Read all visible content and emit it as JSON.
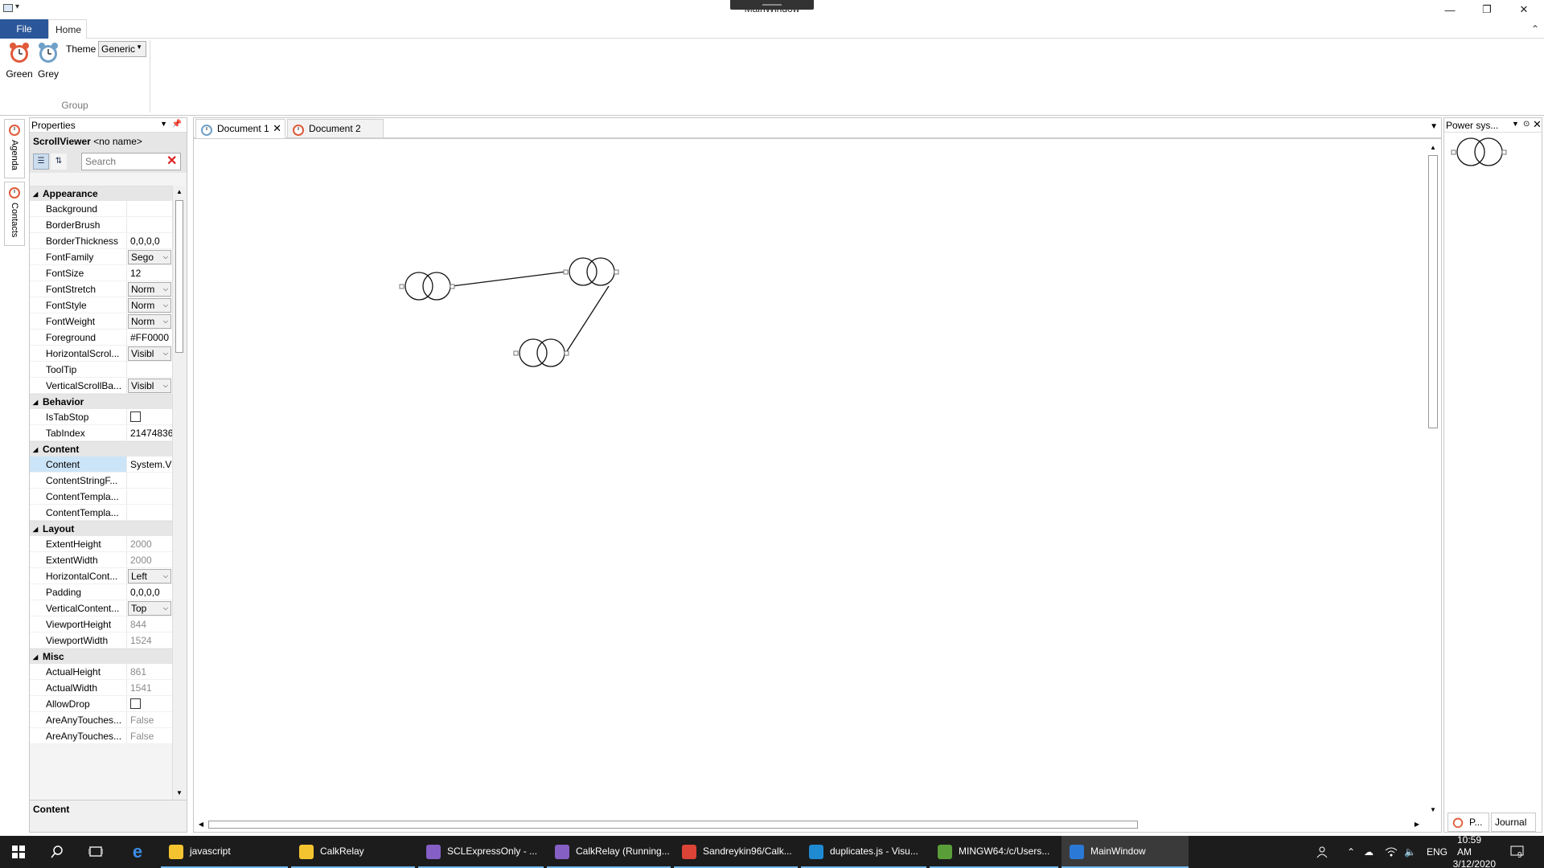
{
  "window": {
    "title": "MainWindow",
    "minimize": "—",
    "restore": "❐",
    "close": "✕"
  },
  "ribbon": {
    "tabs": [
      "File",
      "Home"
    ],
    "buttons": [
      {
        "label": "Green"
      },
      {
        "label": "Grey"
      }
    ],
    "theme_label": "Theme",
    "theme_value": "Generic",
    "group_label": "Group",
    "collapse_glyph": "⌃"
  },
  "sidebar": {
    "tabs": [
      "Agenda",
      "Contacts"
    ]
  },
  "properties": {
    "header": "Properties",
    "object_type": "ScrollViewer",
    "object_name": "<no name>",
    "search_placeholder": "Search",
    "footer": "Content",
    "categories": [
      {
        "name": "Appearance",
        "rows": [
          {
            "name": "Background",
            "value": "",
            "kind": "text"
          },
          {
            "name": "BorderBrush",
            "value": "",
            "kind": "text"
          },
          {
            "name": "BorderThickness",
            "value": "0,0,0,0",
            "kind": "text"
          },
          {
            "name": "FontFamily",
            "value": "Sego",
            "kind": "combo"
          },
          {
            "name": "FontSize",
            "value": "12",
            "kind": "text"
          },
          {
            "name": "FontStretch",
            "value": "Norm",
            "kind": "combo"
          },
          {
            "name": "FontStyle",
            "value": "Norm",
            "kind": "combo"
          },
          {
            "name": "FontWeight",
            "value": "Norm",
            "kind": "combo"
          },
          {
            "name": "Foreground",
            "value": "#FF0000",
            "kind": "text"
          },
          {
            "name": "HorizontalScrol...",
            "value": "Visibl",
            "kind": "combo"
          },
          {
            "name": "ToolTip",
            "value": "",
            "kind": "text"
          },
          {
            "name": "VerticalScrollBa...",
            "value": "Visibl",
            "kind": "combo"
          }
        ]
      },
      {
        "name": "Behavior",
        "rows": [
          {
            "name": "IsTabStop",
            "value": "",
            "kind": "check"
          },
          {
            "name": "TabIndex",
            "value": "21474836",
            "kind": "text"
          }
        ]
      },
      {
        "name": "Content",
        "rows": [
          {
            "name": "Content",
            "value": "System.V",
            "kind": "text",
            "selected": true
          },
          {
            "name": "ContentStringF...",
            "value": "",
            "kind": "text"
          },
          {
            "name": "ContentTempla...",
            "value": "",
            "kind": "text"
          },
          {
            "name": "ContentTempla...",
            "value": "",
            "kind": "text"
          }
        ]
      },
      {
        "name": "Layout",
        "rows": [
          {
            "name": "ExtentHeight",
            "value": "2000",
            "kind": "readonly"
          },
          {
            "name": "ExtentWidth",
            "value": "2000",
            "kind": "readonly"
          },
          {
            "name": "HorizontalCont...",
            "value": "Left",
            "kind": "combo"
          },
          {
            "name": "Padding",
            "value": "0,0,0,0",
            "kind": "text"
          },
          {
            "name": "VerticalContent...",
            "value": "Top",
            "kind": "combo"
          },
          {
            "name": "ViewportHeight",
            "value": "844",
            "kind": "readonly"
          },
          {
            "name": "ViewportWidth",
            "value": "1524",
            "kind": "readonly"
          }
        ]
      },
      {
        "name": "Misc",
        "rows": [
          {
            "name": "ActualHeight",
            "value": "861",
            "kind": "readonly"
          },
          {
            "name": "ActualWidth",
            "value": "1541",
            "kind": "readonly"
          },
          {
            "name": "AllowDrop",
            "value": "",
            "kind": "check"
          },
          {
            "name": "AreAnyTouches...",
            "value": "False",
            "kind": "readonly"
          },
          {
            "name": "AreAnyTouches...",
            "value": "False",
            "kind": "readonly"
          }
        ]
      }
    ]
  },
  "documents": {
    "tabs": [
      {
        "label": "Document 1",
        "active": true
      },
      {
        "label": "Document 2",
        "active": false
      }
    ]
  },
  "right_panel": {
    "header": "Power sys...",
    "bottom_tabs": [
      "P...",
      "Journal"
    ]
  },
  "taskbar": {
    "apps": [
      {
        "label": "javascript",
        "color": "#f4c430"
      },
      {
        "label": "CalkRelay",
        "color": "#f4c430"
      },
      {
        "label": "SCLExpressOnly - ...",
        "color": "#865fc5"
      },
      {
        "label": "CalkRelay (Running...",
        "color": "#865fc5"
      },
      {
        "label": "Sandreykin96/Calk...",
        "color": "#db4437"
      },
      {
        "label": "duplicates.js - Visu...",
        "color": "#1f8ad2"
      },
      {
        "label": "MINGW64:/c/Users...",
        "color": "#5a9e3a"
      },
      {
        "label": "MainWindow",
        "color": "#2b79d6"
      }
    ],
    "language": "ENG",
    "time": "10:59 AM",
    "date": "3/12/2020",
    "notifications": "9"
  }
}
